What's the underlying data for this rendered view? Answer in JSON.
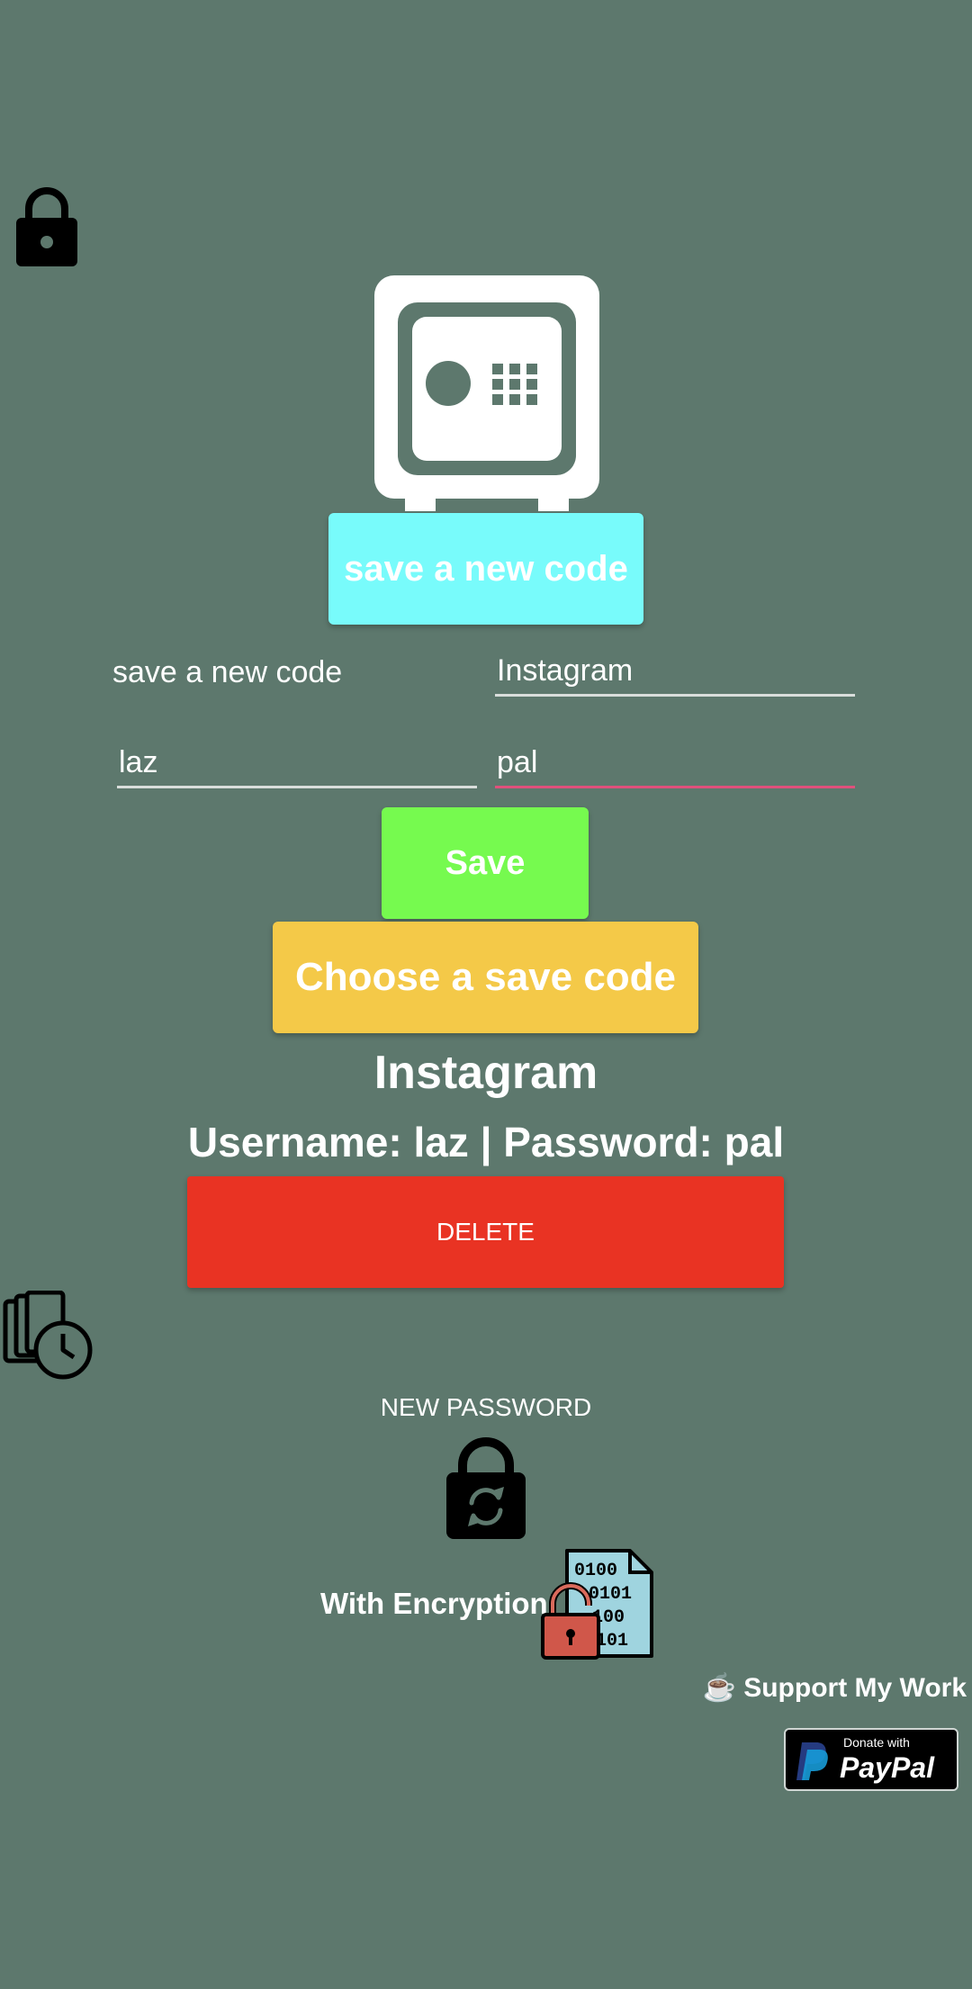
{
  "colors": {
    "background": "#5d786d",
    "save_new_code_button": "#78fbfb",
    "save_button": "#76fa4f",
    "choose_button": "#f4c948",
    "delete_button": "#e93323",
    "active_underline": "#e0507c"
  },
  "header": {
    "lock_icon": "lock-icon"
  },
  "hero": {
    "icon": "safe-icon"
  },
  "buttons": {
    "save_new_code": "save a new code",
    "save": "Save",
    "choose_saved_code": "Choose a save code",
    "delete": "DELETE",
    "new_password": "NEW PASSWORD"
  },
  "form": {
    "label": "save a new code",
    "service_value": "Instagram",
    "username_value": "laz",
    "password_value": "pal"
  },
  "selected": {
    "service": "Instagram",
    "credentials": "Username: laz | Password: pal"
  },
  "encryption": {
    "label": "With Encryption",
    "icon": "encrypted-file-icon"
  },
  "support": {
    "label": "☕ Support My Work",
    "paypal_small": "Donate with",
    "paypal_big": "PayPal"
  }
}
